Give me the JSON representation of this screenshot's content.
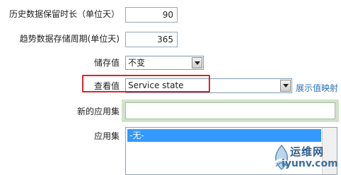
{
  "rows": {
    "history_retention": {
      "label": "历史数据保留时长（单位天）",
      "value": "90"
    },
    "trend_period": {
      "label": "趋势数据存储周期(单位天)",
      "value": "365"
    },
    "storage_value": {
      "label": "储存值",
      "selected": "不变"
    },
    "view_value": {
      "label": "查看值",
      "selected": "Service state",
      "link": "展示值映射"
    },
    "new_app_set": {
      "label": "新的应用集",
      "value": ""
    },
    "app_set": {
      "label": "应用集",
      "items": [
        "-无-"
      ]
    }
  },
  "watermark": {
    "cn": "运维网",
    "en": "iyunv.com"
  },
  "colors": {
    "highlight": "#d9262b",
    "link": "#2a6fb8",
    "selection": "#3399ff",
    "focus_glow": "#cfe3c9"
  }
}
